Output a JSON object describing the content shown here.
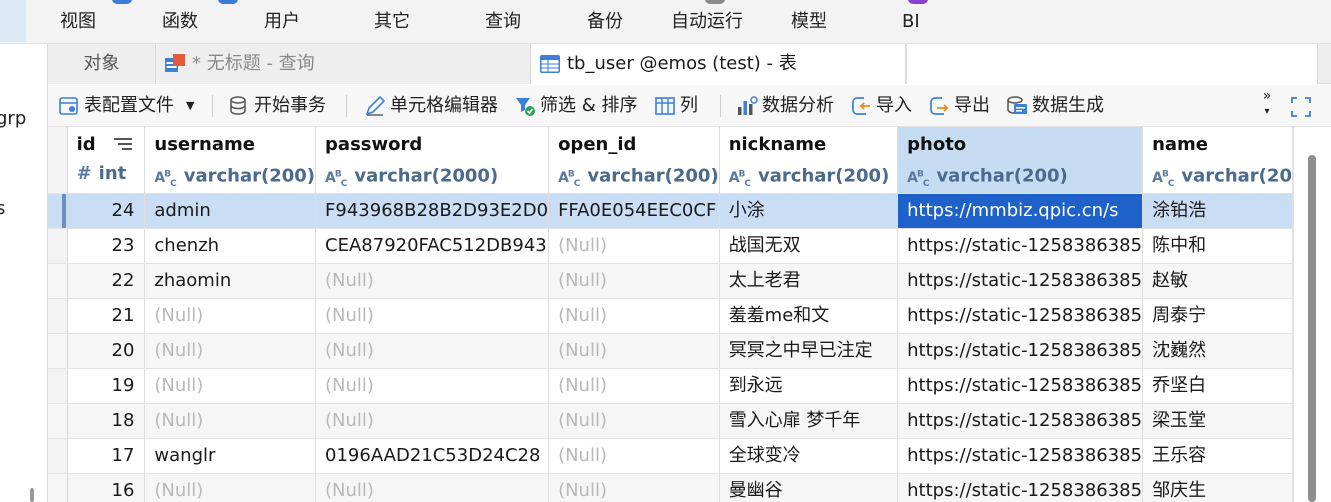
{
  "menu": {
    "items": [
      "视图",
      "函数",
      "用户",
      "其它",
      "查询",
      "备份",
      "自动运行",
      "模型",
      "BI"
    ]
  },
  "left_pane": {
    "fragments": [
      "grp",
      "s"
    ]
  },
  "tabs": {
    "objects": "对象",
    "query": "* 无标题 - 查询",
    "table": "tb_user @emos (test) - 表"
  },
  "toolbar": {
    "table_config": "表配置文件",
    "begin_transaction": "开始事务",
    "cell_editor": "单元格编辑器",
    "filter_sort": "筛选 & 排序",
    "columns": "列",
    "data_analysis": "数据分析",
    "import": "导入",
    "export": "导出",
    "data_generation": "数据生成"
  },
  "colors": {
    "selected_row": "#c9ddf4",
    "focused_cell": "#1e62c9",
    "selected_header": "#c6dcf2",
    "null_text": "#b9b9b9"
  },
  "grid": {
    "columns": [
      {
        "name": "id",
        "type": "int",
        "glyph": "#"
      },
      {
        "name": "username",
        "type": "varchar(200)",
        "glyph": "ABC"
      },
      {
        "name": "password",
        "type": "varchar(2000)",
        "glyph": "ABC"
      },
      {
        "name": "open_id",
        "type": "varchar(200)",
        "glyph": "ABC"
      },
      {
        "name": "nickname",
        "type": "varchar(200)",
        "glyph": "ABC"
      },
      {
        "name": "photo",
        "type": "varchar(200)",
        "glyph": "ABC"
      },
      {
        "name": "name",
        "type": "varchar(20",
        "glyph": "ABC"
      }
    ],
    "rows": [
      [
        "24",
        "admin",
        "F943968B28B2D93E2D0",
        "FFA0E054EEC0CF",
        "小涂",
        "https://mmbiz.qpic.cn/s",
        "涂铂浩"
      ],
      [
        "23",
        "chenzh",
        "CEA87920FAC512DB943",
        "(Null)",
        "战国无双",
        "https://static-1258386385",
        "陈中和"
      ],
      [
        "22",
        "zhaomin",
        "(Null)",
        "(Null)",
        "太上老君",
        "https://static-1258386385",
        "赵敏"
      ],
      [
        "21",
        "(Null)",
        "(Null)",
        "(Null)",
        "羞羞me和文",
        "https://static-1258386385",
        "周泰宁"
      ],
      [
        "20",
        "(Null)",
        "(Null)",
        "(Null)",
        "冥冥之中早已注定",
        "https://static-1258386385",
        "沈巍然"
      ],
      [
        "19",
        "(Null)",
        "(Null)",
        "(Null)",
        "到永远",
        "https://static-1258386385",
        "乔坚白"
      ],
      [
        "18",
        "(Null)",
        "(Null)",
        "(Null)",
        "雪入心扉 梦千年",
        "https://static-1258386385",
        "梁玉堂"
      ],
      [
        "17",
        "wanglr",
        "0196AAD21C53D24C28",
        "(Null)",
        "全球变冷",
        "https://static-1258386385",
        "王乐容"
      ],
      [
        "16",
        "(Null)",
        "(Null)",
        "(Null)",
        "曼幽谷",
        "https://static-1258386385",
        "邹庆生"
      ]
    ]
  }
}
